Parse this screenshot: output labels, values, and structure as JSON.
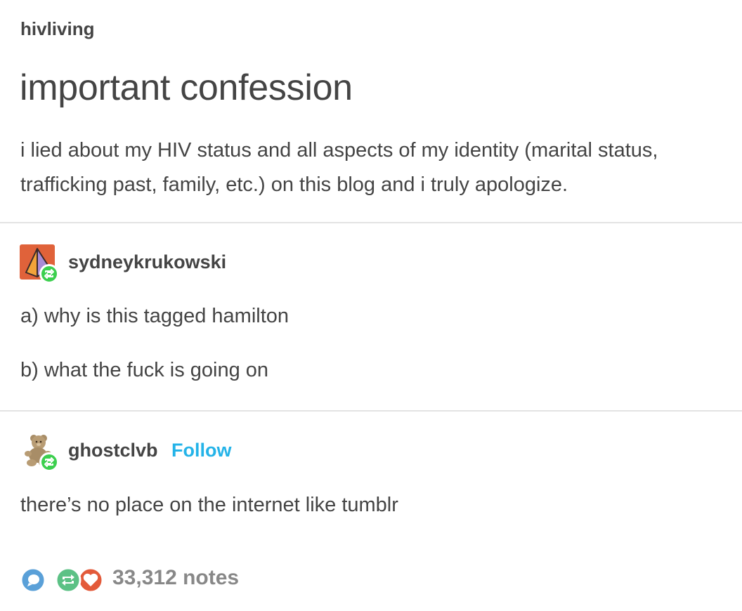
{
  "post": {
    "username": "hivliving",
    "title": "important confession",
    "body": "i lied about my HIV status and all aspects of my identity (marital status, trafficking past, family, etc.) on this blog and i truly apologize."
  },
  "reblogs": [
    {
      "username": "sydneykrukowski",
      "lines": [
        "a) why is this tagged hamilton",
        "b) what the fuck is going on"
      ]
    },
    {
      "username": "ghostclvb",
      "follow_label": "Follow",
      "lines": [
        "there’s no place on the internet like tumblr"
      ]
    }
  ],
  "notes": {
    "count_label": "33,312 notes",
    "icons": [
      "reply-icon",
      "reblog-icon",
      "like-icon"
    ]
  },
  "colors": {
    "text": "#444444",
    "follow": "#24b3e8",
    "reblog_badge": "#3ccf4e",
    "reply_icon": "#5aa0d8",
    "reblog_icon": "#5cc185",
    "like_icon": "#e35a3a",
    "notes_text": "#888888"
  }
}
